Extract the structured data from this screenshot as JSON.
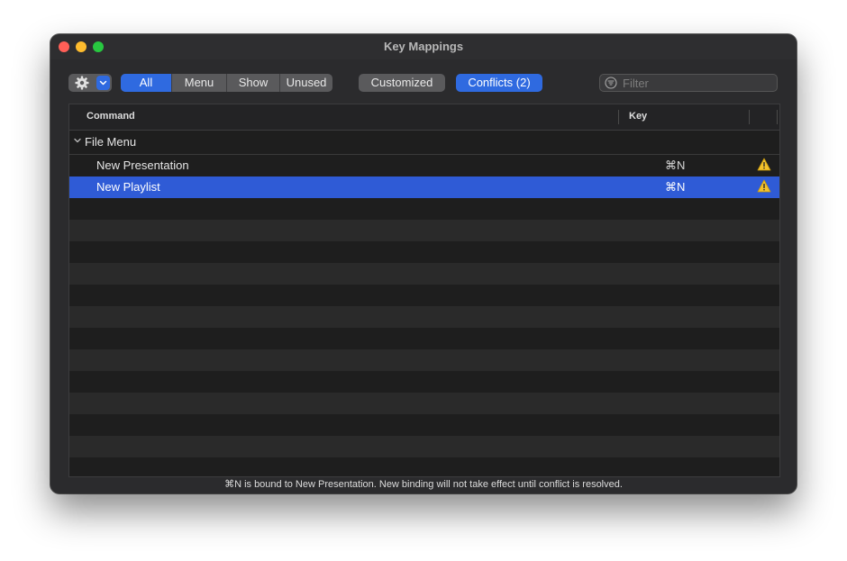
{
  "window": {
    "title": "Key Mappings"
  },
  "toolbar": {
    "segments": [
      "All",
      "Menu",
      "Show",
      "Unused"
    ],
    "active_segment": "All",
    "customized_label": "Customized",
    "conflicts_label": "Conflicts (2)",
    "filter_placeholder": "Filter",
    "filter_value": ""
  },
  "table": {
    "columns": {
      "command": "Command",
      "key": "Key"
    },
    "group": {
      "label": "File Menu",
      "expanded": true
    },
    "rows": [
      {
        "label": "New Presentation",
        "key": "⌘N",
        "warning": true,
        "selected": false
      },
      {
        "label": "New Playlist",
        "key": "⌘N",
        "warning": true,
        "selected": true
      }
    ]
  },
  "status": "⌘N is bound to New Presentation. New binding will not take effect until conflict is resolved.",
  "colors": {
    "accent": "#2f6ae0",
    "selection": "#2f5bd6",
    "warning": "#f4c22b",
    "window_bg": "#2b2b2d"
  }
}
